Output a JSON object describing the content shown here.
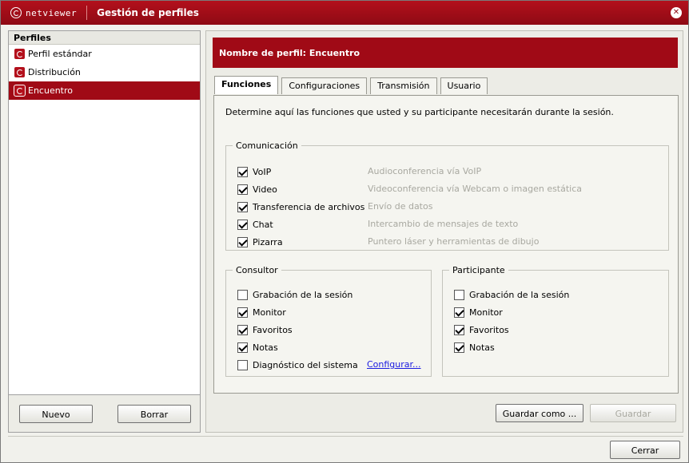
{
  "window": {
    "brand": "netviewer",
    "title": "Gestión de perfiles",
    "close_glyph": "✕"
  },
  "sidebar": {
    "header": "Perfiles",
    "items": [
      {
        "label": "Perfil estándar",
        "selected": false
      },
      {
        "label": "Distribución",
        "selected": false
      },
      {
        "label": "Encuentro",
        "selected": true
      }
    ],
    "new_button": "Nuevo",
    "delete_button": "Borrar"
  },
  "profile": {
    "header": "Nombre de perfil: Encuentro"
  },
  "tabs": [
    {
      "label": "Funciones",
      "active": true
    },
    {
      "label": "Configuraciones",
      "active": false
    },
    {
      "label": "Transmisión",
      "active": false
    },
    {
      "label": "Usuario",
      "active": false
    }
  ],
  "funciones": {
    "intro": "Determine aquí las funciones que usted y su participante necesitarán durante la sesión.",
    "comunicacion": {
      "legend": "Comunicación",
      "items": [
        {
          "label": "VoIP",
          "checked": true,
          "desc": "Audioconferencia vía VoIP"
        },
        {
          "label": "Video",
          "checked": true,
          "desc": "Videoconferencia vía Webcam o imagen estática"
        },
        {
          "label": "Transferencia de archivos",
          "checked": true,
          "desc": "Envío de datos"
        },
        {
          "label": "Chat",
          "checked": true,
          "desc": "Intercambio de mensajes de texto"
        },
        {
          "label": "Pizarra",
          "checked": true,
          "desc": "Puntero láser y herramientas de dibujo"
        }
      ]
    },
    "consultor": {
      "legend": "Consultor",
      "items": [
        {
          "label": "Grabación de la sesión",
          "checked": false
        },
        {
          "label": "Monitor",
          "checked": true
        },
        {
          "label": "Favoritos",
          "checked": true
        },
        {
          "label": "Notas",
          "checked": true
        },
        {
          "label": "Diagnóstico del sistema",
          "checked": false
        }
      ],
      "configure_link": "Configurar..."
    },
    "participante": {
      "legend": "Participante",
      "items": [
        {
          "label": "Grabación de la sesión",
          "checked": false
        },
        {
          "label": "Monitor",
          "checked": true
        },
        {
          "label": "Favoritos",
          "checked": true
        },
        {
          "label": "Notas",
          "checked": true
        }
      ]
    }
  },
  "actions": {
    "save_as": "Guardar como ...",
    "save": "Guardar",
    "close": "Cerrar"
  }
}
